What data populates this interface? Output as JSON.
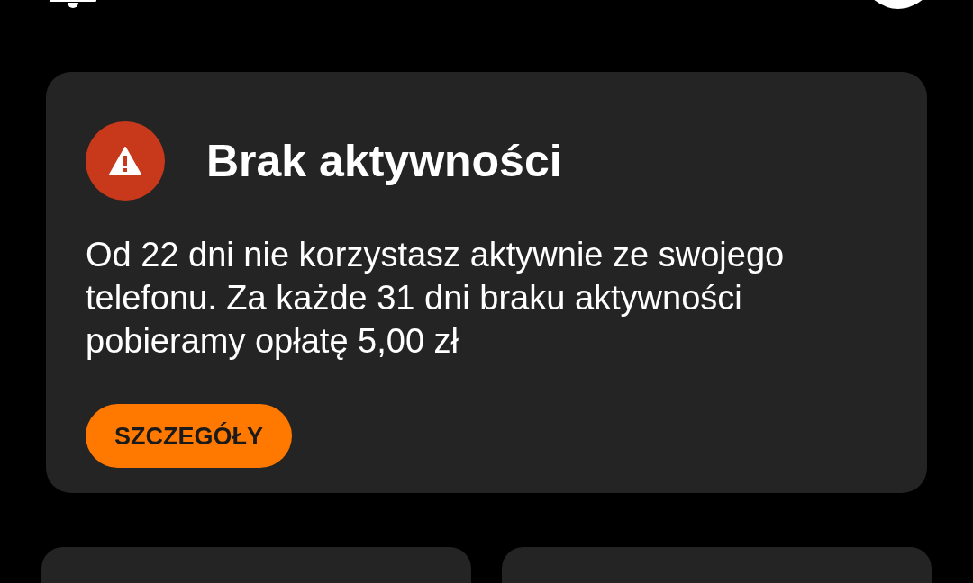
{
  "alert": {
    "warning": true,
    "title": "Brak aktywności",
    "message": "Od 22 dni nie korzystasz aktywnie ze swojego telefonu. Za każde 31 dni braku aktywności pobieramy opłatę 5,00 zł",
    "button": "SZCZEGÓŁY"
  }
}
